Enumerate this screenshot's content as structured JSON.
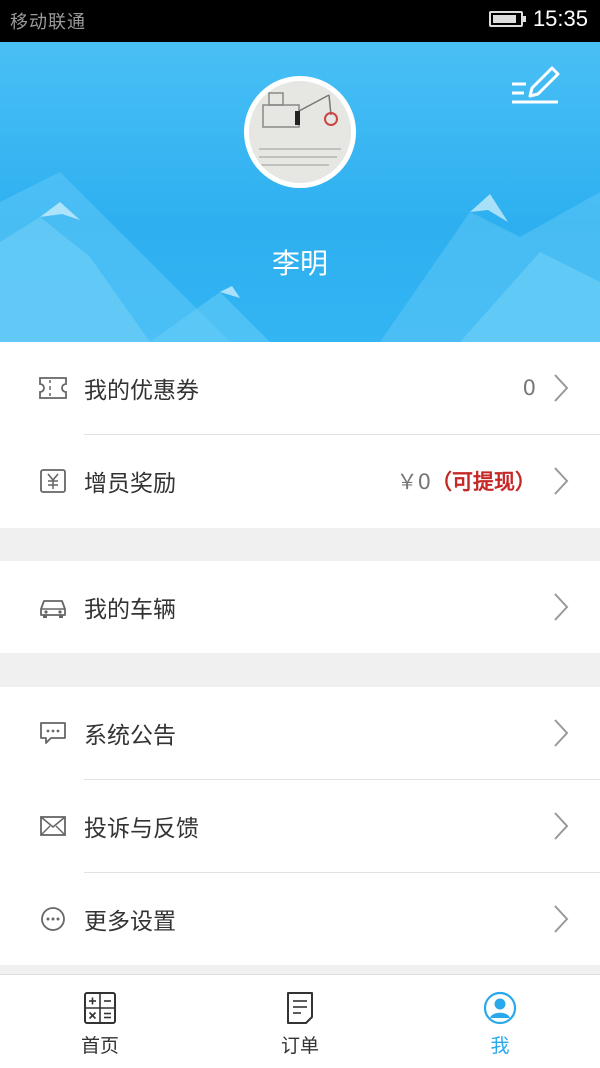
{
  "status": {
    "time": "15:35",
    "carrier": "移动联通"
  },
  "profile": {
    "name": "李明"
  },
  "menu": {
    "coupons": {
      "label": "我的优惠券",
      "value": "0"
    },
    "reward": {
      "label": "增员奖励",
      "value": "￥0",
      "withdraw": "（可提现）"
    },
    "vehicle": {
      "label": "我的车辆"
    },
    "notice": {
      "label": "系统公告"
    },
    "feedback": {
      "label": "投诉与反馈"
    },
    "settings": {
      "label": "更多设置"
    }
  },
  "tabs": [
    {
      "label": "首页",
      "icon": "calculator-grid-icon"
    },
    {
      "label": "订单",
      "icon": "document-icon"
    },
    {
      "label": "我",
      "icon": "user-icon"
    }
  ],
  "colors": {
    "accent": "#29a9ec",
    "header": "#33b4f3",
    "warn": "#c62828"
  },
  "battery_level": 0.9
}
